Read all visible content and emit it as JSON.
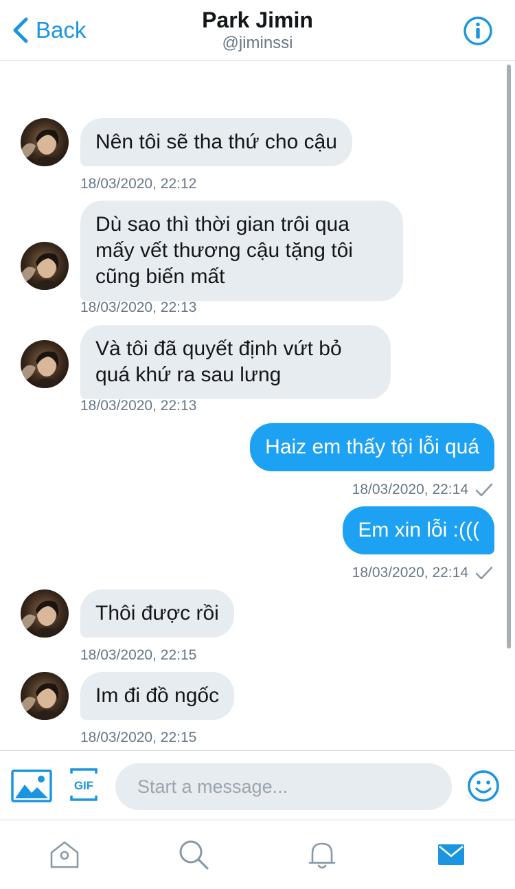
{
  "header": {
    "back_label": "Back",
    "title": "Park Jimin",
    "handle": "@jiminssi"
  },
  "messages": [
    {
      "direction": "in",
      "text": "Nên tôi sẽ tha thứ cho cậu",
      "time": "18/03/2020, 22:12"
    },
    {
      "direction": "in",
      "text": "Dù sao thì thời gian trôi qua mấy vết thương cậu tặng tôi cũng biến mất",
      "time": "18/03/2020, 22:13"
    },
    {
      "direction": "in",
      "text": "Và tôi đã quyết định vứt bỏ quá khứ ra sau lưng",
      "time": "18/03/2020, 22:13"
    },
    {
      "direction": "out",
      "text": "Haiz em thấy tội lỗi quá",
      "time": "18/03/2020, 22:14"
    },
    {
      "direction": "out",
      "text": "Em xin lỗi :(((",
      "time": "18/03/2020, 22:14"
    },
    {
      "direction": "in",
      "text": "Thôi được rồi",
      "time": "18/03/2020, 22:15"
    },
    {
      "direction": "in",
      "text": "Im đi đồ ngốc",
      "time": "18/03/2020, 22:15"
    }
  ],
  "composer": {
    "placeholder": "Start a message..."
  },
  "tabbar": {
    "items": [
      "home-icon",
      "search-icon",
      "bell-icon",
      "mail-icon"
    ],
    "active": "mail-icon"
  },
  "colors": {
    "accent": "#1da1f2",
    "incoming_bubble": "#e6ecf0",
    "muted_text": "#657786"
  }
}
